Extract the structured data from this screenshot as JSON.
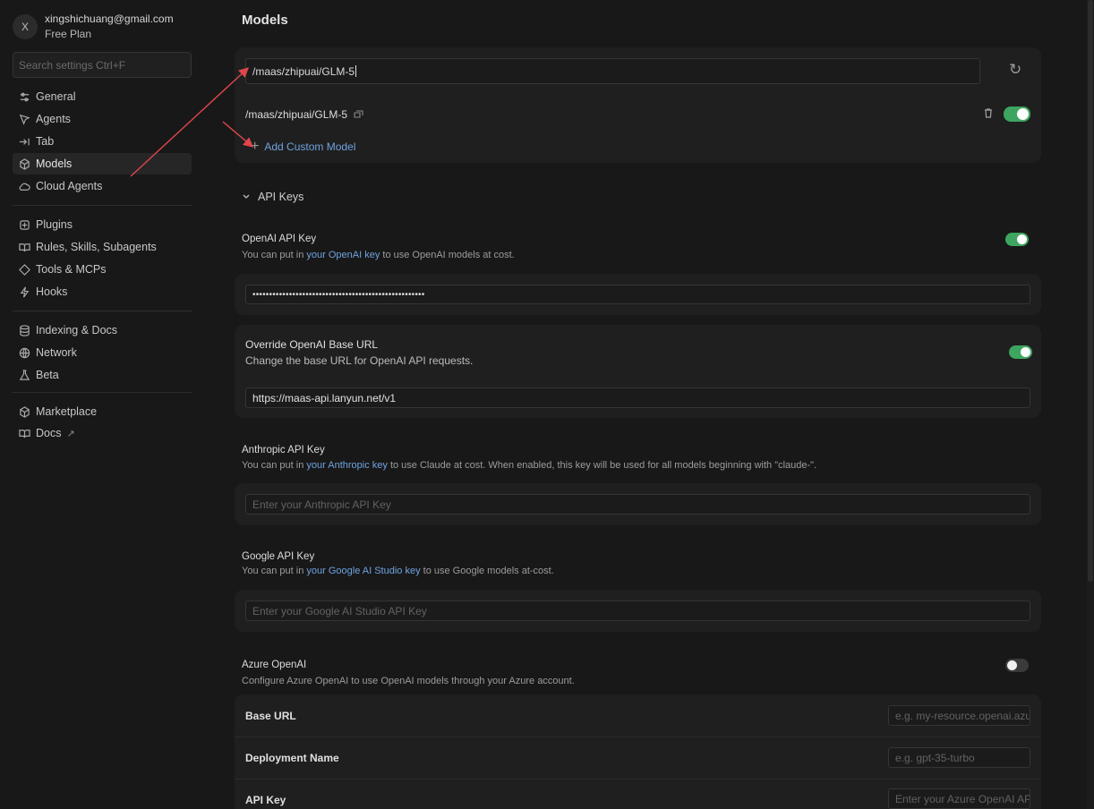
{
  "profile": {
    "avatar_letter": "X",
    "email": "xingshichuang@gmail.com",
    "plan": "Free Plan"
  },
  "search": {
    "placeholder": "Search settings Ctrl+F"
  },
  "sidebar": {
    "items": [
      {
        "label": "General",
        "icon": "sliders-icon"
      },
      {
        "label": "Agents",
        "icon": "agent-icon"
      },
      {
        "label": "Tab",
        "icon": "tab-arrow-icon"
      },
      {
        "label": "Models",
        "icon": "cube-icon",
        "active": true
      },
      {
        "label": "Cloud Agents",
        "icon": "cloud-icon"
      },
      {
        "label": "Plugins",
        "icon": "plugin-icon"
      },
      {
        "label": "Rules, Skills, Subagents",
        "icon": "book-icon"
      },
      {
        "label": "Tools & MCPs",
        "icon": "tools-icon"
      },
      {
        "label": "Hooks",
        "icon": "hook-icon"
      },
      {
        "label": "Indexing & Docs",
        "icon": "database-icon"
      },
      {
        "label": "Network",
        "icon": "globe-icon"
      },
      {
        "label": "Beta",
        "icon": "flask-icon"
      },
      {
        "label": "Marketplace",
        "icon": "cube-icon"
      },
      {
        "label": "Docs",
        "icon": "book-icon",
        "external": "↗"
      }
    ]
  },
  "main": {
    "title": "Models",
    "models": {
      "search_value": "/maas/zhipuai/GLM-5",
      "refresh_icon": "↻",
      "model_name": "/maas/zhipuai/GLM-5",
      "model_enabled": true,
      "add_label": "Add Custom Model",
      "add_icon": "+"
    },
    "api_keys": {
      "section_title": "API Keys",
      "openai": {
        "label": "OpenAI API Key",
        "desc_pre": "You can put in ",
        "desc_link": "your OpenAI key",
        "desc_post": " to use OpenAI models at cost.",
        "enabled": true,
        "value": "••••••••••••••••••••••••••••••••••••••••••••••••••••"
      },
      "override": {
        "label": "Override OpenAI Base URL",
        "desc": "Change the base URL for OpenAI API requests.",
        "enabled": true,
        "value": "https://maas-api.lanyun.net/v1"
      },
      "anthropic": {
        "label": "Anthropic API Key",
        "desc_pre": "You can put in ",
        "desc_link": "your Anthropic key",
        "desc_post": " to use Claude at cost. When enabled, this key will be used for all models beginning with \"claude-\".",
        "placeholder": "Enter your Anthropic API Key"
      },
      "google": {
        "label": "Google API Key",
        "desc_pre": "You can put in ",
        "desc_link": "your Google AI Studio key",
        "desc_post": " to use Google models at-cost.",
        "placeholder": "Enter your Google AI Studio API Key"
      },
      "azure": {
        "label": "Azure OpenAI",
        "desc": "Configure Azure OpenAI to use OpenAI models through your Azure account.",
        "enabled": false,
        "base_url_label": "Base URL",
        "base_url_placeholder": "e.g. my-resource.openai.azure.com",
        "deployment_label": "Deployment Name",
        "deployment_placeholder": "e.g. gpt-35-turbo",
        "api_key_label": "API Key",
        "api_key_placeholder": "Enter your Azure OpenAI API Key"
      }
    }
  },
  "colors": {
    "accent_toggle": "#3ea561",
    "link": "#6ea3e0",
    "annotation_arrow": "#e0464a"
  }
}
